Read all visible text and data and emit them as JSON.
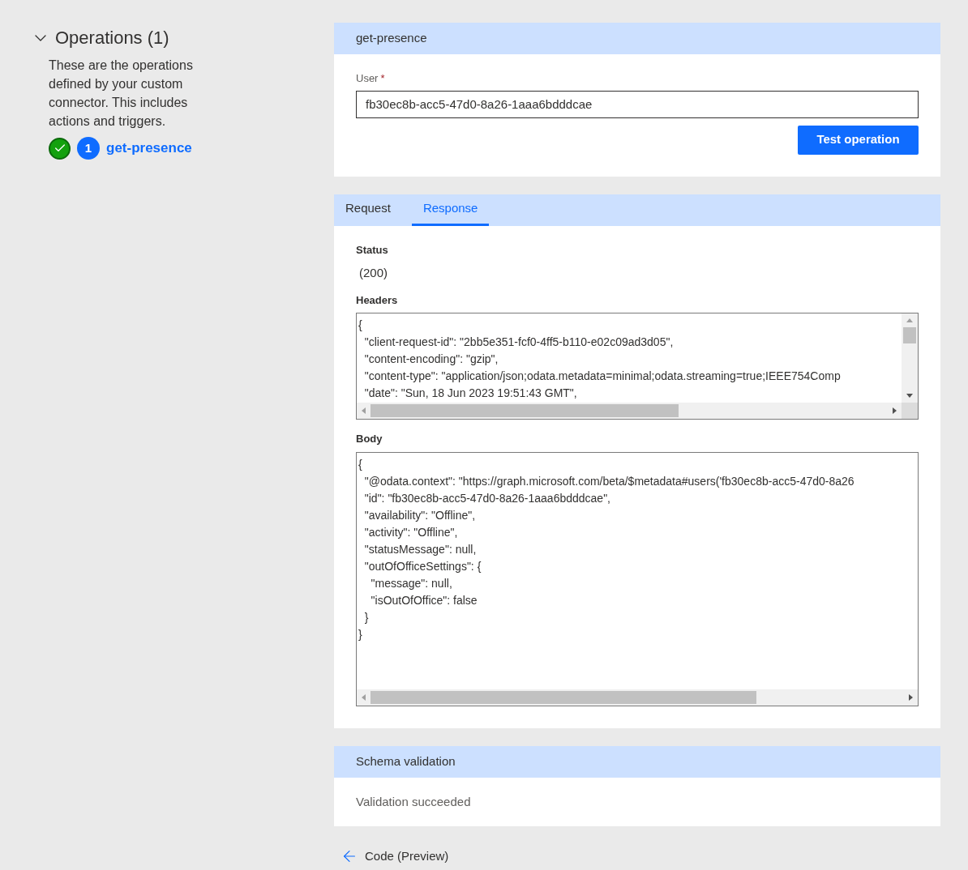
{
  "operations": {
    "title": "Operations (1)",
    "expanded": true,
    "description": "These are the operations defined by your custom connector. This includes actions and triggers.",
    "items": [
      {
        "number": "1",
        "label": "get-presence",
        "valid": true
      }
    ]
  },
  "operation_panel": {
    "title": "get-presence",
    "field": {
      "label": "User",
      "required": true,
      "required_mark": "*",
      "value": "fb30ec8b-acc5-47d0-8a26-1aaa6bdddcae"
    },
    "button": "Test operation"
  },
  "tabs": [
    {
      "label": "Request",
      "selected": false
    },
    {
      "label": "Response",
      "selected": true
    }
  ],
  "response": {
    "status_label": "Status",
    "status": "(200)",
    "headers_label": "Headers",
    "headers": [
      "{",
      "  \"client-request-id\": \"2bb5e351-fcf0-4ff5-b110-e02c09ad3d05\",",
      "  \"content-encoding\": \"gzip\",",
      "  \"content-type\": \"application/json;odata.metadata=minimal;odata.streaming=true;IEEE754Comp",
      "  \"date\": \"Sun, 18 Jun 2023 19:51:43 GMT\","
    ],
    "body_label": "Body",
    "body": [
      "{",
      "  \"@odata.context\": \"https://graph.microsoft.com/beta/$metadata#users('fb30ec8b-acc5-47d0-8a26",
      "  \"id\": \"fb30ec8b-acc5-47d0-8a26-1aaa6bdddcae\",",
      "  \"availability\": \"Offline\",",
      "  \"activity\": \"Offline\",",
      "  \"statusMessage\": null,",
      "  \"outOfOfficeSettings\": {",
      "    \"message\": null,",
      "    \"isOutOfOffice\": false",
      "  }",
      "}"
    ]
  },
  "schema_validation": {
    "title": "Schema validation",
    "message": "Validation succeeded"
  },
  "back_link": "Code (Preview)"
}
